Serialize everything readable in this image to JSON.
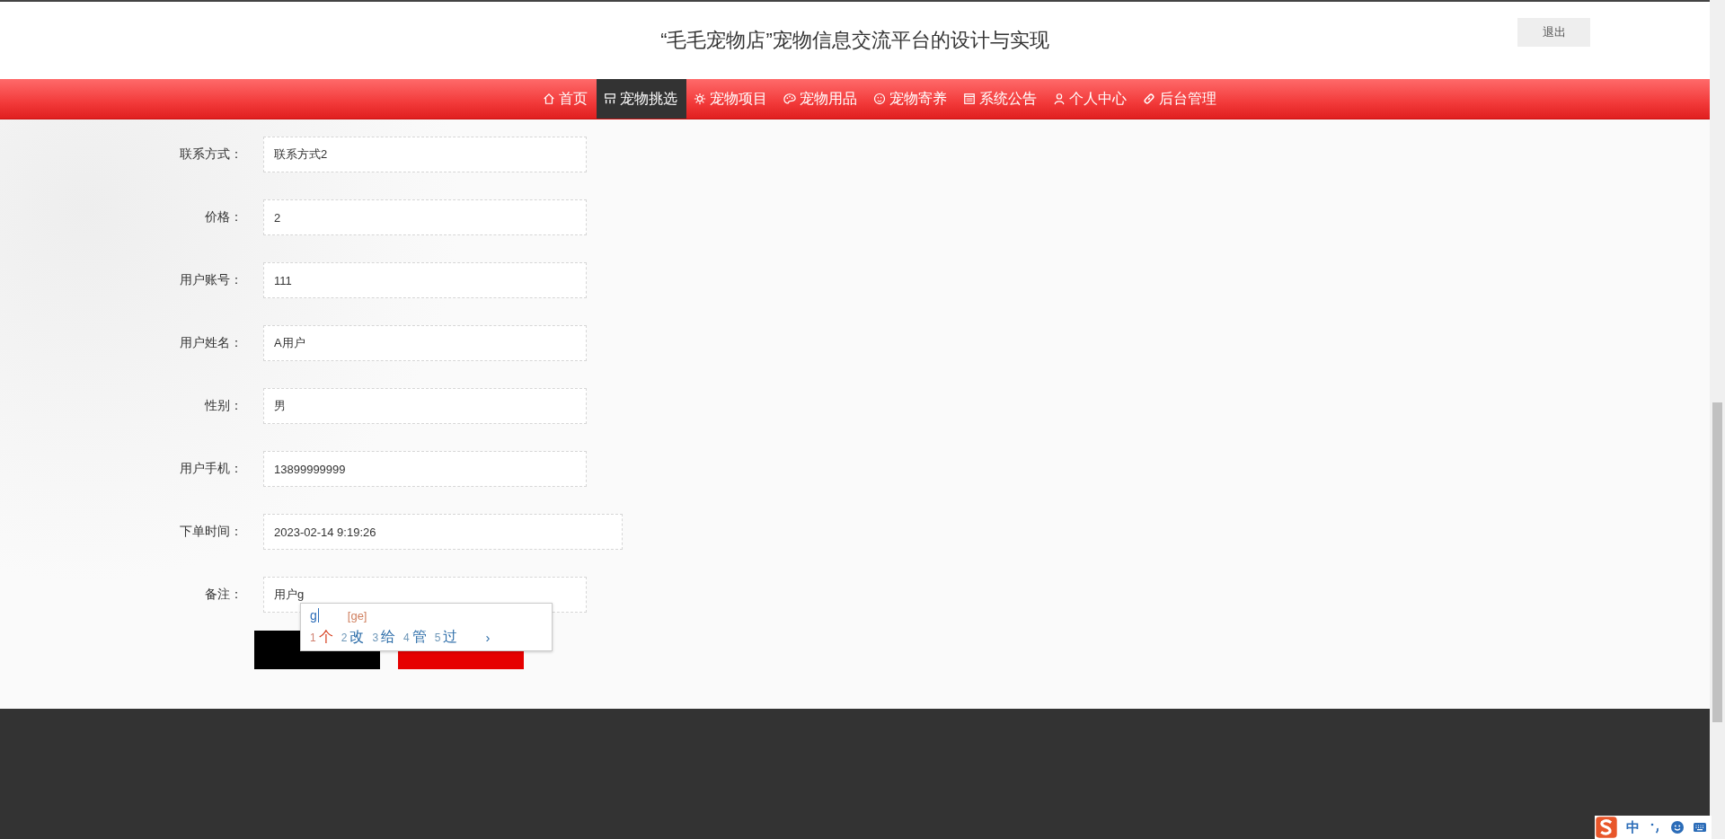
{
  "header": {
    "title": "“毛毛宠物店”宠物信息交流平台的设计与实现",
    "logout": "退出"
  },
  "nav": [
    {
      "label": "首页",
      "selected": false
    },
    {
      "label": "宠物挑选",
      "selected": true
    },
    {
      "label": "宠物项目",
      "selected": false
    },
    {
      "label": "宠物用品",
      "selected": false
    },
    {
      "label": "宠物寄养",
      "selected": false
    },
    {
      "label": "系统公告",
      "selected": false
    },
    {
      "label": "个人中心",
      "selected": false
    },
    {
      "label": "后台管理",
      "selected": false
    }
  ],
  "form": {
    "fields": [
      {
        "label": "联系方式：",
        "value": "联系方式2",
        "kind": "text"
      },
      {
        "label": "价格：",
        "value": "2",
        "kind": "text"
      },
      {
        "label": "用户账号：",
        "value": "111",
        "kind": "text"
      },
      {
        "label": "用户姓名：",
        "value": "A用户",
        "kind": "text"
      },
      {
        "label": "性别：",
        "value": "男",
        "kind": "text"
      },
      {
        "label": "用户手机：",
        "value": "13899999999",
        "kind": "text"
      },
      {
        "label": "下单时间：",
        "value": "2023-02-14 9:19:26",
        "kind": "date"
      },
      {
        "label": "备注：",
        "value": "用户g",
        "kind": "text"
      }
    ],
    "buttons": [
      {
        "kind": "submit"
      },
      {
        "kind": "reset"
      }
    ]
  },
  "ime": {
    "composition": "g",
    "pinyin": "[ge]",
    "candidates": [
      {
        "index": "1",
        "text": "个",
        "selected": true
      },
      {
        "index": "2",
        "text": "改",
        "selected": false
      },
      {
        "index": "3",
        "text": "给",
        "selected": false
      },
      {
        "index": "4",
        "text": "管",
        "selected": false
      },
      {
        "index": "5",
        "text": "过",
        "selected": false
      }
    ],
    "more": "›"
  },
  "ime_status": {
    "mode": "中"
  }
}
